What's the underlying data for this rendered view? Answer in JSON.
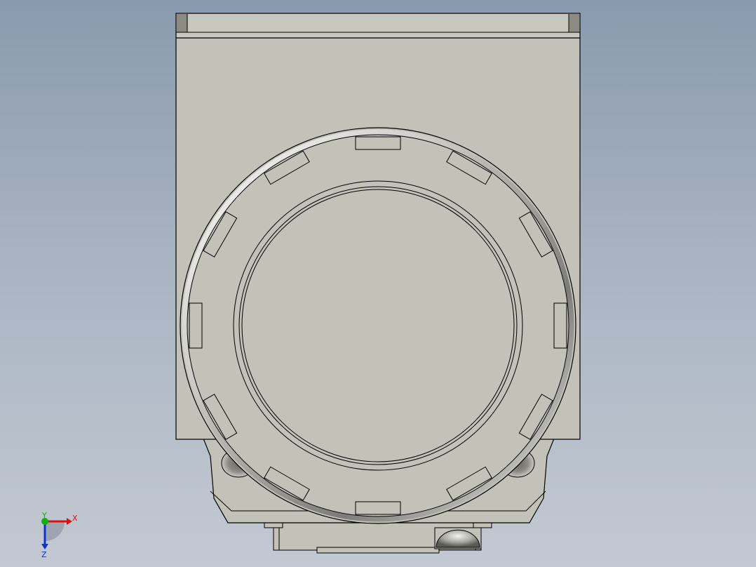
{
  "viewport": {
    "background_top": "#8a9aae",
    "background_bottom": "#c3c9d2"
  },
  "model": {
    "body_color": "#c2c2b9",
    "edge_color": "#000000",
    "highlight_color": "#ffffff",
    "shade_color": "#6f6f69"
  },
  "triad": {
    "x_label": "X",
    "y_label": "Y",
    "z_label": "Z",
    "x_color": "#e01010",
    "y_color": "#10b010",
    "z_color": "#1030d0"
  }
}
